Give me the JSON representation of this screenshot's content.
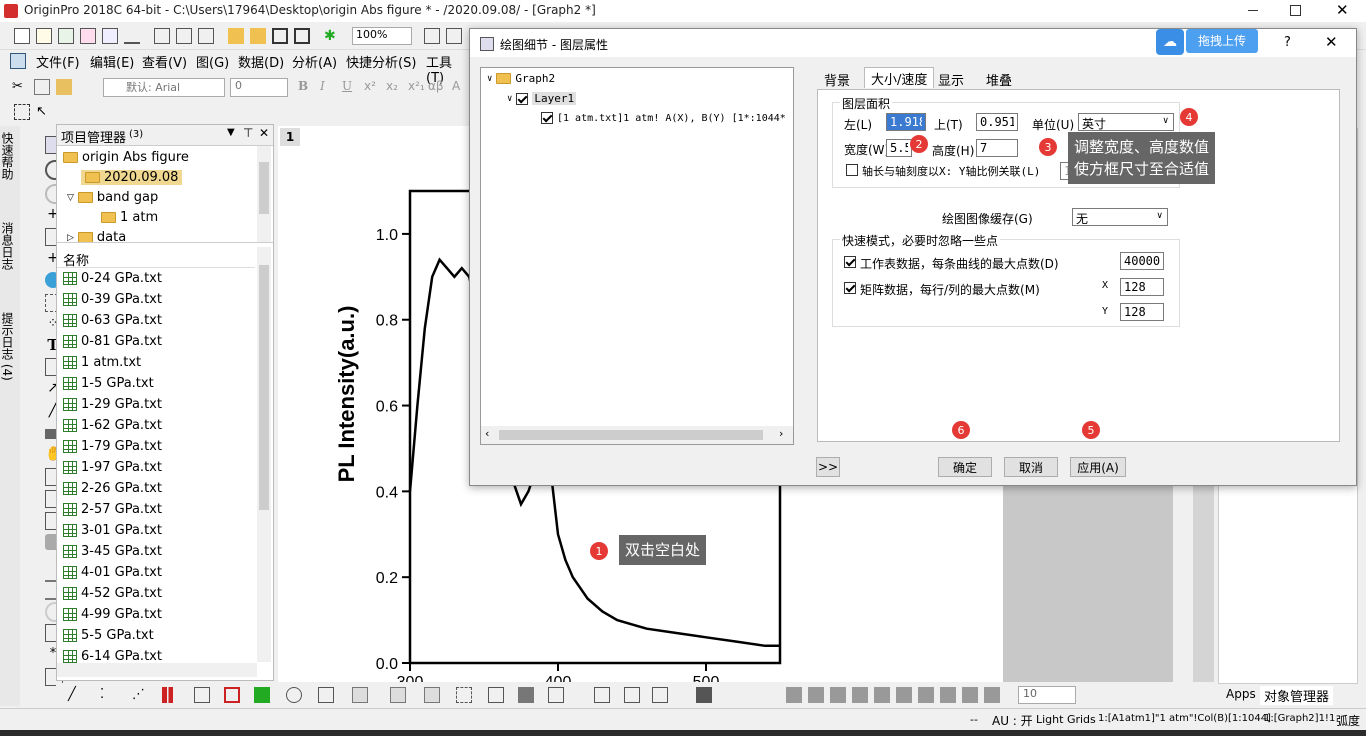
{
  "app": {
    "title": "OriginPro 2018C 64-bit - C:\\Users\\17964\\Desktop\\origin Abs figure * - /2020.09.08/ - [Graph2 *]"
  },
  "menu": [
    "文件(F)",
    "编辑(E)",
    "查看(V)",
    "图(G)",
    "数据(D)",
    "分析(A)",
    "快捷分析(S)",
    "工具(T)"
  ],
  "toolbar": {
    "zoom": "100%",
    "font": "默认: Arial",
    "font_size": "0"
  },
  "side_tabs": [
    "快速帮助",
    "消息日志",
    "提示日志 (4)"
  ],
  "project_manager": {
    "title": "项目管理器",
    "count": "(3)",
    "tree": [
      {
        "label": "origin Abs figure",
        "level": 0
      },
      {
        "label": "2020.09.08",
        "level": 1,
        "selected": true
      },
      {
        "label": "band gap",
        "level": 1
      },
      {
        "label": "1 atm",
        "level": 2
      },
      {
        "label": "data",
        "level": 1
      }
    ],
    "list_header": "名称",
    "files": [
      "0-24 GPa.txt",
      "0-39 GPa.txt",
      "0-63 GPa.txt",
      "0-81 GPa.txt",
      "1 atm.txt",
      "1-5 GPa.txt",
      "1-29 GPa.txt",
      "1-62 GPa.txt",
      "1-79 GPa.txt",
      "1-97 GPa.txt",
      "2-26 GPa.txt",
      "2-57 GPa.txt",
      "3-01 GPa.txt",
      "3-45 GPa.txt",
      "4-01 GPa.txt",
      "4-52 GPa.txt",
      "4-99 GPa.txt",
      "5-5 GPa.txt",
      "6-14 GPa.txt"
    ]
  },
  "graph": {
    "page_number": "1",
    "y_label": "PL Intensity(a.u.)",
    "y_ticks": [
      "0.0",
      "0.2",
      "0.4",
      "0.6",
      "0.8",
      "1.0"
    ],
    "x_ticks_partial": [
      "300",
      "400",
      "500"
    ]
  },
  "chart_data": {
    "type": "line",
    "ylabel": "PL Intensity(a.u.)",
    "xlabel": "",
    "ylim": [
      0,
      1.1
    ],
    "xlim": [
      300,
      550
    ],
    "x": [
      300,
      305,
      310,
      315,
      320,
      325,
      330,
      335,
      340,
      350,
      360,
      370,
      375,
      380,
      390,
      395,
      400,
      405,
      410,
      420,
      430,
      440,
      450,
      460,
      480,
      500,
      520,
      540,
      550
    ],
    "y": [
      0.4,
      0.6,
      0.78,
      0.9,
      0.94,
      0.92,
      0.9,
      0.92,
      0.9,
      0.75,
      0.6,
      0.42,
      0.37,
      0.4,
      0.5,
      0.45,
      0.3,
      0.24,
      0.2,
      0.15,
      0.12,
      0.1,
      0.09,
      0.08,
      0.07,
      0.06,
      0.05,
      0.04,
      0.04
    ]
  },
  "dialog": {
    "title": "绘图细节 - 图层属性",
    "upload_label": "拖拽上传",
    "help": "?",
    "close": "✕",
    "tree": {
      "root": "Graph2",
      "layer": "Layer1",
      "plot": "[1 atm.txt]1 atm! A(X), B(Y) [1*:1044*"
    },
    "tabs": [
      "背景",
      "大小/速度",
      "显示",
      "堆叠"
    ],
    "active_tab": "大小/速度",
    "area_group": "图层面积",
    "left_label": "左(L)",
    "left_value": "1.918",
    "top_label": "上(T)",
    "top_value": "0.9517",
    "unit_label": "单位(U)",
    "unit_value": "英寸",
    "width_label": "宽度(W)",
    "width_value": "5.5",
    "height_label": "高度(H)",
    "height_value": "7",
    "axis_link_label": "轴长与轴刻度以X: Y轴比例关联(L)",
    "axis_link_value": "1",
    "cache_label": "绘图图像缓存(G)",
    "cache_value": "无",
    "fast_group": "快速模式，必要时忽略一些点",
    "ws_label": "工作表数据，每条曲线的最大点数(D)",
    "ws_value": "40000",
    "matrix_label": "矩阵数据，每行/列的最大点数(M)",
    "x_label": "X",
    "x_value": "128",
    "y_label": "Y",
    "y_value": "128",
    "expand": ">>",
    "ok": "确定",
    "cancel": "取消",
    "apply": "应用(A)"
  },
  "annotations": {
    "m1": "1",
    "m2": "2",
    "m3": "3",
    "m4": "4",
    "m5": "5",
    "m6": "6",
    "c1": "双击空白处",
    "c3_line1": "调整宽度、高度数值",
    "c3_line2": "使方框尺寸至合适值"
  },
  "right_panel": {
    "tab_apps": "Apps",
    "tab_objects": "对象管理器"
  },
  "statusbar": {
    "dash": "--",
    "au": "AU : 开",
    "grid": "Light Grids",
    "col": "1:[A1atm1]\"1 atm\"!Col(B)[1:1044]",
    "graph": "1:[Graph2]1!1",
    "unit": "弧度"
  },
  "bottom_toolbar": {
    "size": "10"
  }
}
